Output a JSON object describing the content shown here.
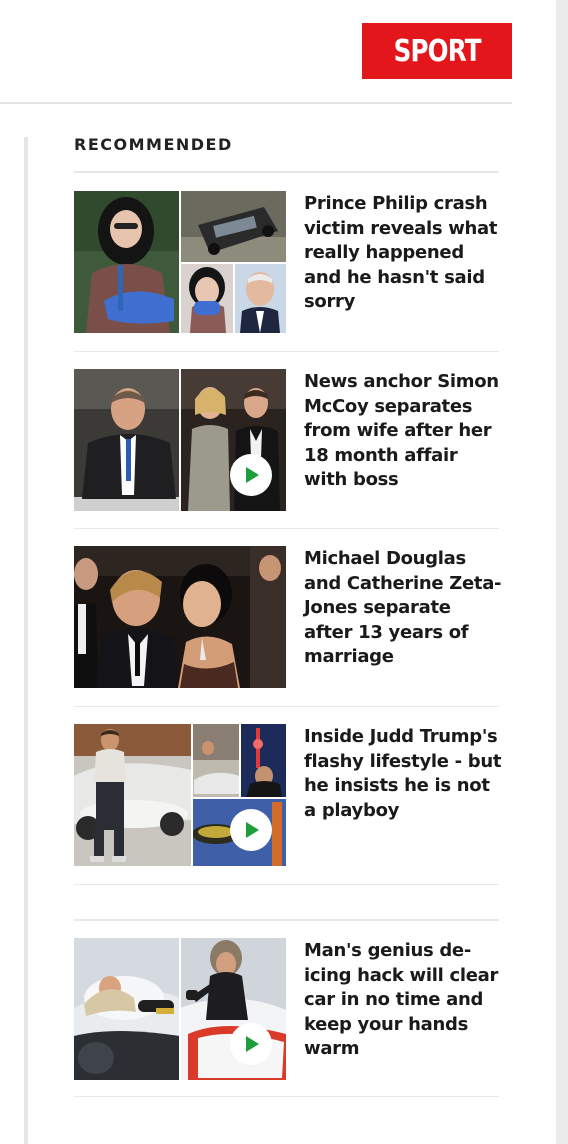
{
  "header": {
    "section_button": "SPORT"
  },
  "section": {
    "title": "RECOMMENDED"
  },
  "articles": [
    {
      "headline": "Prince Philip crash victim reveals what really happened and he hasn't said sorry",
      "has_video": false
    },
    {
      "headline": "News anchor Simon McCoy separates from wife after her 18 month affair with boss",
      "has_video": true
    },
    {
      "headline": "Michael Douglas and Catherine Zeta-Jones separate after 13 years of marriage",
      "has_video": false
    },
    {
      "headline": "Inside Judd Trump's flashy lifestyle - but he insists he is not a playboy",
      "has_video": true
    },
    {
      "headline": "Man's genius de-icing hack will clear car in no time and keep your hands warm",
      "has_video": true
    }
  ],
  "colors": {
    "brand_red": "#e3161b",
    "play_green": "#1e9e3a"
  }
}
